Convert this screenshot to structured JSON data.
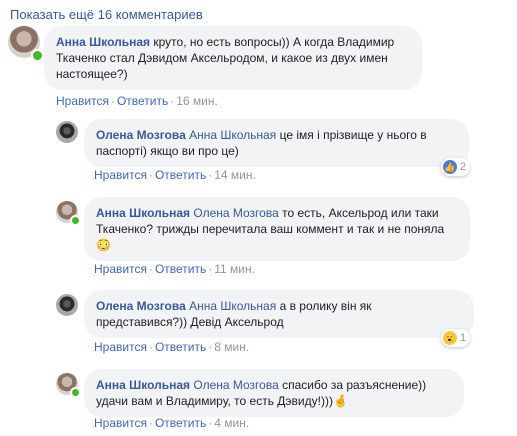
{
  "more_comments": "Показать ещё 16 комментариев",
  "comments": [
    {
      "author": "Анна Школьная",
      "mention": "",
      "text": "круто, но есть вопросы)) А когда Владимир Ткаченко стал Дэвидом Аксельродом, и какое из двух имен настоящее?)",
      "like": "Нравится",
      "reply": "Ответить",
      "time": "16 мин."
    },
    {
      "author": "Олена Мозгова",
      "mention": "Анна Школьная",
      "text": "це імя і прізвище у нього в паспорті) якщо ви про це)",
      "like": "Нравится",
      "reply": "Ответить",
      "time": "14 мин.",
      "reaction_count": "2"
    },
    {
      "author": "Анна Школьная",
      "mention": "Олена Мозгова",
      "text": "то есть, Аксельрод или таки Ткаченко? трижды перечитала ваш коммент и так и не поняла",
      "emoji": "😳",
      "like": "Нравится",
      "reply": "Ответить",
      "time": "11 мин."
    },
    {
      "author": "Олена Мозгова",
      "mention": "Анна Школьная",
      "text": "а в ролику він як представився?)) Девід Аксельрод",
      "like": "Нравится",
      "reply": "Ответить",
      "time": "8 мин.",
      "reaction_count": "1"
    },
    {
      "author": "Анна Школьная",
      "mention": "Олена Мозгова",
      "text": "спасибо за разъяснение)) удачи вам и Владимиру, то есть Дэвиду!)))",
      "emoji": "🤞",
      "like": "Нравится",
      "reply": "Ответить",
      "time": "4 мин."
    }
  ],
  "reaction_icons": {
    "like": "👍",
    "wow": "😮"
  }
}
